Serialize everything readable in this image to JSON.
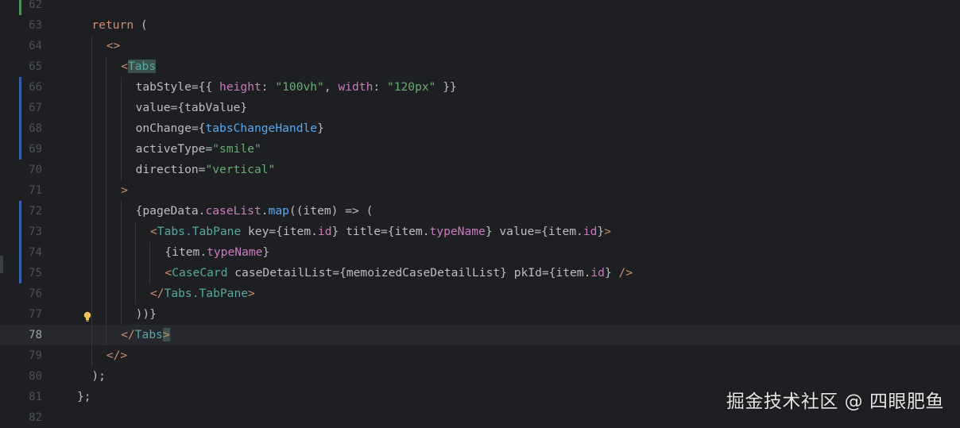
{
  "colors": {
    "background": "#1e1f22",
    "current_line": "#26282e",
    "keyword": "#cf8e6d",
    "tag": "#56a8a0",
    "attribute": "#bcbec4",
    "string": "#6aab73",
    "property": "#c77dbb",
    "function": "#56a8f5",
    "default": "#bcbec4"
  },
  "editor": {
    "lines": [
      {
        "num": "62",
        "indent": 0,
        "gutter": "added",
        "tokens": []
      },
      {
        "num": "63",
        "indent": 1,
        "tokens": [
          {
            "t": "return",
            "c": "kw"
          },
          {
            "t": " (",
            "c": "p"
          }
        ]
      },
      {
        "num": "64",
        "indent": 2,
        "tokens": [
          {
            "t": "<>",
            "c": "kw"
          }
        ]
      },
      {
        "num": "65",
        "indent": 3,
        "tokens": [
          {
            "t": "<",
            "c": "kw"
          },
          {
            "t": "Tabs",
            "c": "tag",
            "hl": true
          }
        ]
      },
      {
        "num": "66",
        "indent": 4,
        "gutter": "modified",
        "tokens": [
          {
            "t": "tabStyle",
            "c": "attr"
          },
          {
            "t": "={{ ",
            "c": "p"
          },
          {
            "t": "height",
            "c": "prop"
          },
          {
            "t": ": ",
            "c": "p"
          },
          {
            "t": "\"100vh\"",
            "c": "str"
          },
          {
            "t": ", ",
            "c": "p"
          },
          {
            "t": "width",
            "c": "prop"
          },
          {
            "t": ": ",
            "c": "p"
          },
          {
            "t": "\"120px\"",
            "c": "str"
          },
          {
            "t": " }}",
            "c": "p"
          }
        ]
      },
      {
        "num": "67",
        "indent": 4,
        "gutter": "modified",
        "tokens": [
          {
            "t": "value",
            "c": "attr"
          },
          {
            "t": "={tabValue}",
            "c": "p"
          }
        ]
      },
      {
        "num": "68",
        "indent": 4,
        "gutter": "modified",
        "tokens": [
          {
            "t": "onChange",
            "c": "attr"
          },
          {
            "t": "={",
            "c": "p"
          },
          {
            "t": "tabsChangeHandle",
            "c": "fn"
          },
          {
            "t": "}",
            "c": "p"
          }
        ]
      },
      {
        "num": "69",
        "indent": 4,
        "gutter": "modified",
        "tokens": [
          {
            "t": "activeType",
            "c": "attr"
          },
          {
            "t": "=",
            "c": "p"
          },
          {
            "t": "\"smile\"",
            "c": "str"
          }
        ]
      },
      {
        "num": "70",
        "indent": 4,
        "tokens": [
          {
            "t": "direction",
            "c": "attr"
          },
          {
            "t": "=",
            "c": "p"
          },
          {
            "t": "\"vertical\"",
            "c": "str"
          }
        ]
      },
      {
        "num": "71",
        "indent": 3,
        "tokens": [
          {
            "t": ">",
            "c": "kw"
          }
        ]
      },
      {
        "num": "72",
        "indent": 4,
        "gutter": "modified",
        "tokens": [
          {
            "t": "{pageData.",
            "c": "p"
          },
          {
            "t": "caseList",
            "c": "prop"
          },
          {
            "t": ".",
            "c": "p"
          },
          {
            "t": "map",
            "c": "fn"
          },
          {
            "t": "((item) => (",
            "c": "p"
          }
        ]
      },
      {
        "num": "73",
        "indent": 5,
        "gutter": "modified",
        "tokens": [
          {
            "t": "<",
            "c": "kw"
          },
          {
            "t": "Tabs.TabPane",
            "c": "tag"
          },
          {
            "t": " key",
            "c": "attr"
          },
          {
            "t": "={item.",
            "c": "p"
          },
          {
            "t": "id",
            "c": "prop"
          },
          {
            "t": "}",
            "c": "p"
          },
          {
            "t": " title",
            "c": "attr"
          },
          {
            "t": "={item.",
            "c": "p"
          },
          {
            "t": "typeName",
            "c": "prop"
          },
          {
            "t": "}",
            "c": "p"
          },
          {
            "t": " value",
            "c": "attr"
          },
          {
            "t": "={item.",
            "c": "p"
          },
          {
            "t": "id",
            "c": "prop"
          },
          {
            "t": "}",
            "c": "p"
          },
          {
            "t": ">",
            "c": "kw"
          }
        ]
      },
      {
        "num": "74",
        "indent": 6,
        "gutter": "modified",
        "tokens": [
          {
            "t": "{item.",
            "c": "p"
          },
          {
            "t": "typeName",
            "c": "prop"
          },
          {
            "t": "}",
            "c": "p"
          }
        ]
      },
      {
        "num": "75",
        "indent": 6,
        "gutter": "modified",
        "tokens": [
          {
            "t": "<",
            "c": "kw"
          },
          {
            "t": "CaseCard",
            "c": "tag"
          },
          {
            "t": " caseDetailList",
            "c": "attr"
          },
          {
            "t": "={memoizedCaseDetailList}",
            "c": "p"
          },
          {
            "t": " pkId",
            "c": "attr"
          },
          {
            "t": "={item.",
            "c": "p"
          },
          {
            "t": "id",
            "c": "prop"
          },
          {
            "t": "}",
            "c": "p"
          },
          {
            "t": " />",
            "c": "kw"
          }
        ]
      },
      {
        "num": "76",
        "indent": 5,
        "tokens": [
          {
            "t": "</",
            "c": "kw"
          },
          {
            "t": "Tabs.TabPane",
            "c": "tag"
          },
          {
            "t": ">",
            "c": "kw"
          }
        ]
      },
      {
        "num": "77",
        "indent": 4,
        "bulb": true,
        "tokens": [
          {
            "t": "))}",
            "c": "p"
          }
        ]
      },
      {
        "num": "78",
        "indent": 3,
        "current": true,
        "tokens": [
          {
            "t": "</",
            "c": "kw"
          },
          {
            "t": "Tabs",
            "c": "tag"
          },
          {
            "t": ">",
            "c": "kw",
            "hl": true
          }
        ]
      },
      {
        "num": "79",
        "indent": 2,
        "tokens": [
          {
            "t": "</>",
            "c": "kw"
          }
        ]
      },
      {
        "num": "80",
        "indent": 1,
        "tokens": [
          {
            "t": ");",
            "c": "p"
          }
        ]
      },
      {
        "num": "81",
        "indent": 0,
        "tokens": [
          {
            "t": "};",
            "c": "p"
          }
        ]
      },
      {
        "num": "82",
        "indent": 0,
        "tokens": []
      }
    ]
  },
  "watermark": "掘金技术社区 @ 四眼肥鱼",
  "icons": {
    "intention_bulb": "lightbulb-icon"
  }
}
